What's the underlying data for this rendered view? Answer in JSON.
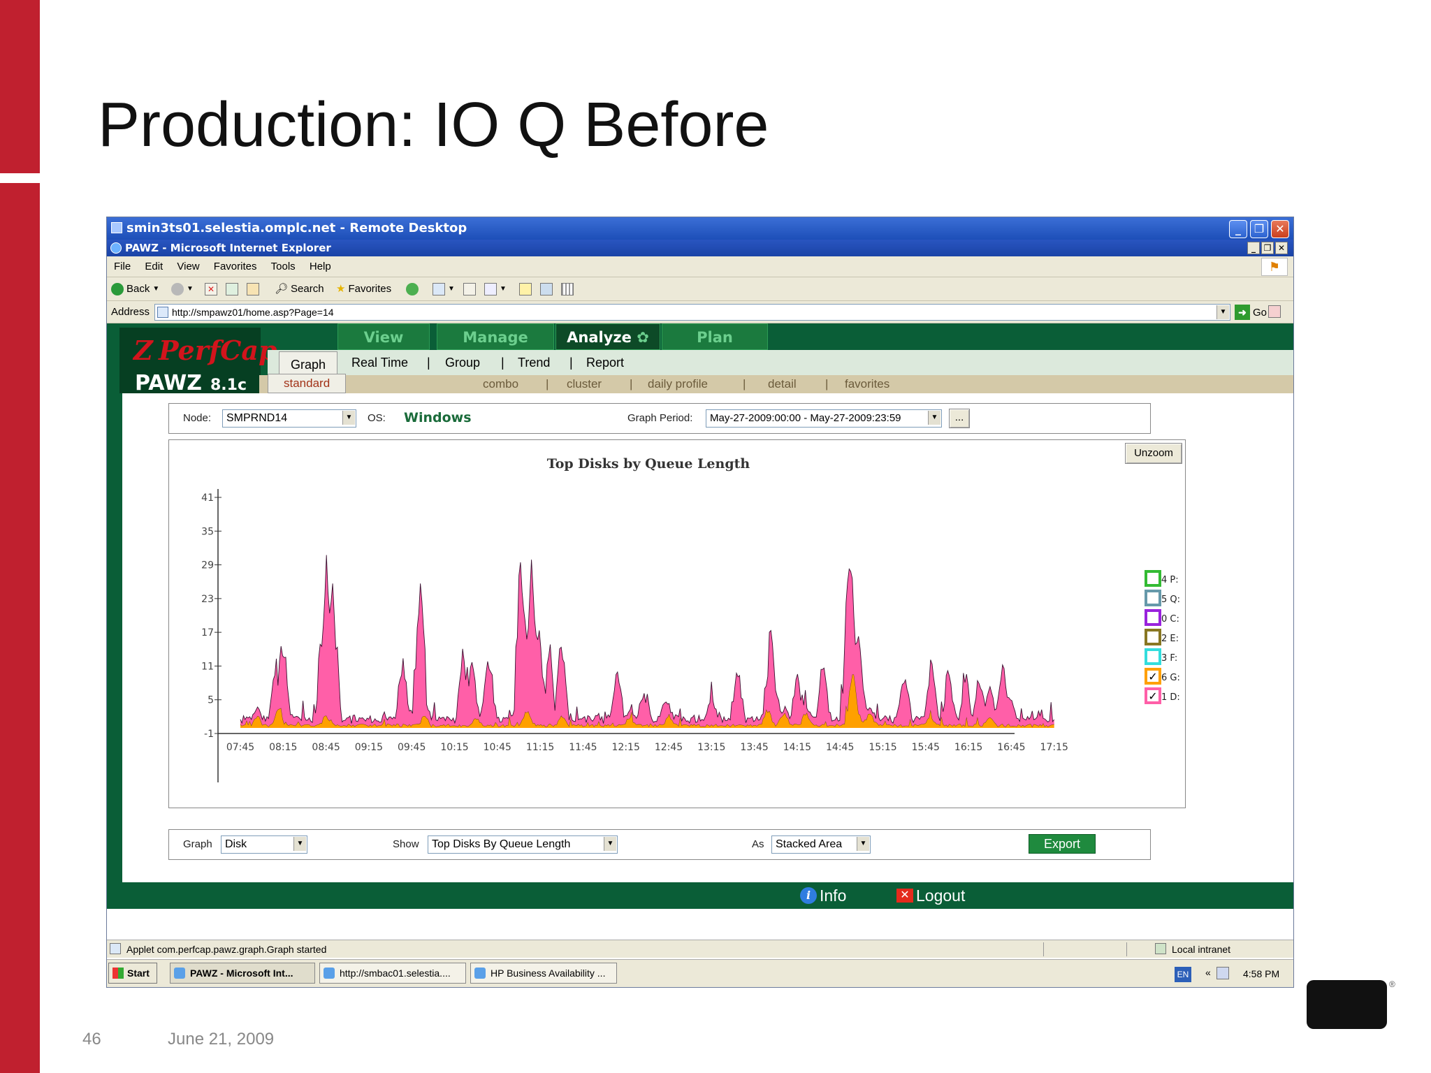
{
  "slide": {
    "title": "Production: IO Q Before",
    "page_number": "46",
    "date": "June 21, 2009",
    "logo_text": "hp",
    "brand_color": "#c0202f"
  },
  "remote_desktop": {
    "title": "smin3ts01.selestia.omplc.net - Remote Desktop"
  },
  "browser": {
    "title": "PAWZ - Microsoft Internet Explorer",
    "menu": [
      "File",
      "Edit",
      "View",
      "Favorites",
      "Tools",
      "Help"
    ],
    "toolbar": {
      "back": "Back",
      "search": "Search",
      "favorites": "Favorites"
    },
    "address_label": "Address",
    "address_url": "http://smpawz01/home.asp?Page=14",
    "go": "Go"
  },
  "app": {
    "logo_name": "PerfCap",
    "logo_mark": "Z",
    "product": "PAWZ",
    "version": "8.1c",
    "main_tabs": [
      "View",
      "Manage",
      "Analyze",
      "Plan"
    ],
    "active_main_tab": "Analyze",
    "sub_tabs": [
      "Graph",
      "Real Time",
      "Group",
      "Trend",
      "Report"
    ],
    "sub_sub_tabs": [
      "standard",
      "combo",
      "cluster",
      "daily profile",
      "detail",
      "favorites"
    ],
    "separator": "|",
    "filters": {
      "node_label": "Node:",
      "node_value": "SMPRND14",
      "os_label": "OS:",
      "os_value": "Windows",
      "period_label": "Graph Period:",
      "period_value": "May-27-2009:00:00 - May-27-2009:23:59",
      "period_button": "..."
    },
    "unzoom": "Unzoom",
    "bottom": {
      "graph_label": "Graph",
      "graph_value": "Disk",
      "show_label": "Show",
      "show_value": "Top Disks By Queue Length",
      "as_label": "As",
      "as_value": "Stacked Area",
      "export": "Export"
    },
    "footer": {
      "info": "Info",
      "logout": "Logout"
    }
  },
  "status": {
    "left": "Applet com.perfcap.pawz.graph.Graph started",
    "zone": "Local intranet"
  },
  "taskbar": {
    "start": "Start",
    "tasks": [
      "PAWZ - Microsoft Int...",
      "http://smbac01.selestia....",
      "HP Business Availability ..."
    ],
    "lang": "EN",
    "tray_chevron": "«",
    "clock": "4:58 PM"
  },
  "chart_data": {
    "type": "area",
    "title": "Top Disks by Queue Length",
    "xlabel": "",
    "ylabel": "",
    "y_ticks": [
      -1,
      5,
      11,
      17,
      23,
      29,
      35,
      41
    ],
    "ylim": [
      -1,
      41
    ],
    "x_ticks": [
      "07:45",
      "08:15",
      "08:45",
      "09:15",
      "09:45",
      "10:15",
      "10:45",
      "11:15",
      "11:45",
      "12:15",
      "12:45",
      "13:15",
      "13:45",
      "14:15",
      "14:45",
      "15:15",
      "15:45",
      "16:15",
      "16:45",
      "17:15"
    ],
    "legend_placement": "right",
    "legend": [
      {
        "label": "4 P:",
        "checked": false,
        "color": "#33bb33"
      },
      {
        "label": "5 Q:",
        "checked": false,
        "color": "#6699aa"
      },
      {
        "label": "0 C:",
        "checked": false,
        "color": "#9922dd"
      },
      {
        "label": "2 E:",
        "checked": false,
        "color": "#887722"
      },
      {
        "label": "3 F:",
        "checked": false,
        "color": "#33dddd"
      },
      {
        "label": "6 G:",
        "checked": true,
        "color": "#ffa000"
      },
      {
        "label": "1 D:",
        "checked": true,
        "color": "#ff5fa8"
      }
    ],
    "series": [
      {
        "name": "6 G:",
        "color": "#ffa000",
        "peaks": [
          [
            7.95,
            2.2
          ],
          [
            8.2,
            4.2
          ],
          [
            8.75,
            2.4
          ],
          [
            9.9,
            2.6
          ],
          [
            10.5,
            2.0
          ],
          [
            11.1,
            3.2
          ],
          [
            11.5,
            2.4
          ],
          [
            12.3,
            2.0
          ],
          [
            12.75,
            2.6
          ],
          [
            13.9,
            3.5
          ],
          [
            14.1,
            2.8
          ],
          [
            14.35,
            3.0
          ],
          [
            14.9,
            10
          ],
          [
            15.1,
            3.2
          ],
          [
            15.8,
            2.2
          ],
          [
            16.5,
            2.4
          ]
        ]
      },
      {
        "name": "1 D:",
        "color": "#ff5fa8",
        "peaks": [
          [
            8.15,
            9
          ],
          [
            8.25,
            14
          ],
          [
            8.7,
            17
          ],
          [
            8.75,
            29
          ],
          [
            8.83,
            25
          ],
          [
            9.65,
            12
          ],
          [
            9.85,
            26
          ],
          [
            10.35,
            14
          ],
          [
            10.45,
            11
          ],
          [
            10.65,
            13
          ],
          [
            11.02,
            31
          ],
          [
            11.15,
            29
          ],
          [
            11.22,
            20
          ],
          [
            11.35,
            13
          ],
          [
            11.5,
            14
          ],
          [
            12.15,
            10
          ],
          [
            12.45,
            6
          ],
          [
            12.7,
            4
          ],
          [
            13.25,
            6
          ],
          [
            13.55,
            10
          ],
          [
            13.95,
            16
          ],
          [
            14.25,
            9
          ],
          [
            14.55,
            12
          ],
          [
            14.85,
            27
          ],
          [
            14.97,
            14
          ],
          [
            15.5,
            10
          ],
          [
            15.82,
            10
          ],
          [
            16.02,
            11
          ],
          [
            16.22,
            10
          ],
          [
            16.38,
            8
          ],
          [
            16.5,
            6
          ],
          [
            16.65,
            12
          ],
          [
            16.75,
            5
          ]
        ]
      }
    ]
  }
}
